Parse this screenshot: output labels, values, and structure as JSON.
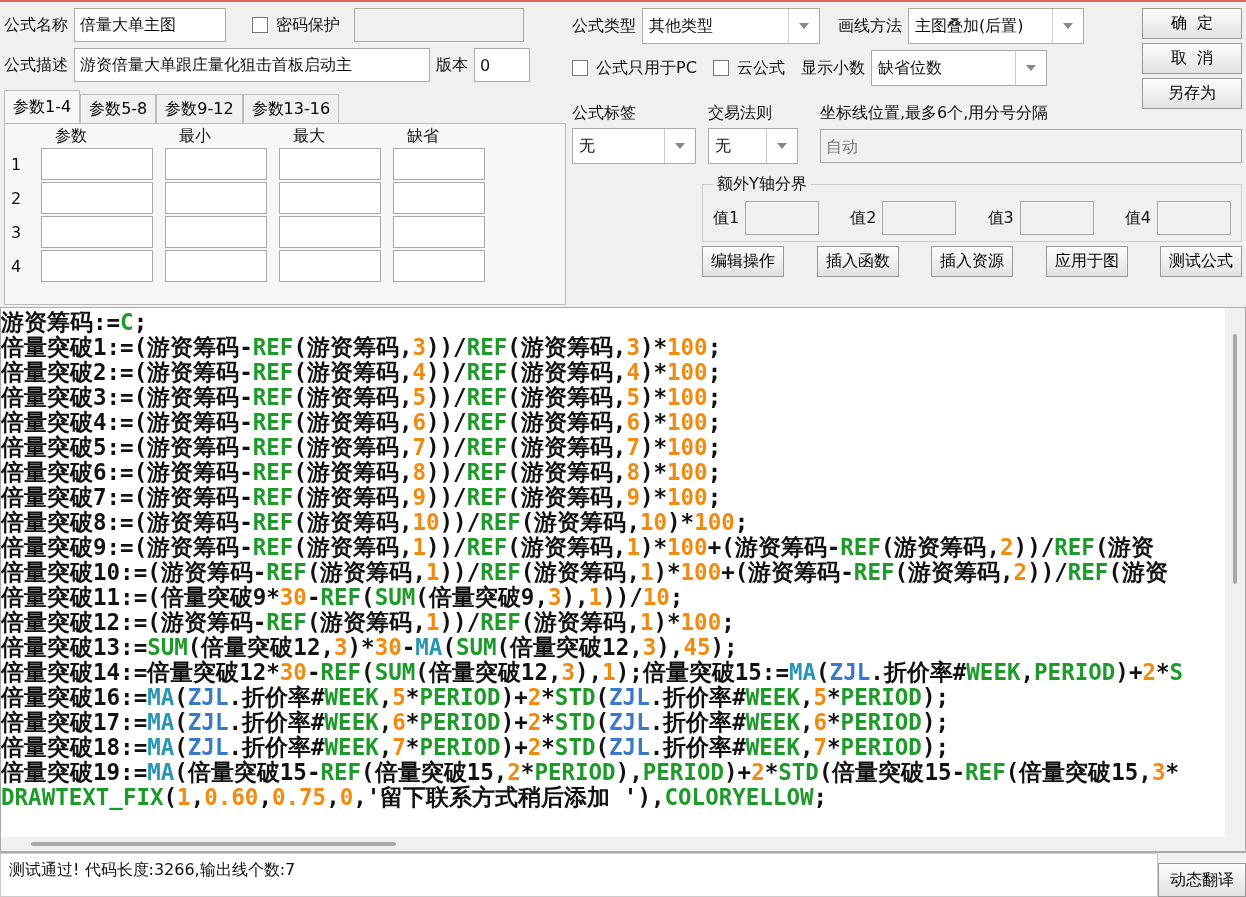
{
  "form": {
    "name_label": "公式名称",
    "name_value": "倍量大单主图",
    "password": {
      "label": "密码保护",
      "checked": false
    },
    "description_label": "公式描述",
    "description_value": "游资倍量大单跟庄量化狙击首板启动主",
    "version_label": "版本",
    "version_value": "0"
  },
  "param_tabs": [
    {
      "label": "参数1-4",
      "selected": true
    },
    {
      "label": "参数5-8",
      "selected": false
    },
    {
      "label": "参数9-12",
      "selected": false
    },
    {
      "label": "参数13-16",
      "selected": false
    }
  ],
  "param_table": {
    "columns": [
      "参数",
      "最小",
      "最大",
      "缺省"
    ],
    "rows": [
      "1",
      "2",
      "3",
      "4"
    ]
  },
  "type": {
    "label": "公式类型",
    "value": "其他类型"
  },
  "draw_method": {
    "label": "画线方法",
    "value": "主图叠加(后置)"
  },
  "options": [
    {
      "label": "公式只用于PC",
      "checked": false
    },
    {
      "label": "云公式",
      "checked": false
    }
  ],
  "decimals": {
    "label": "显示小数",
    "value": "缺省位数"
  },
  "dialog_buttons": [
    "确  定",
    "取  消",
    "另存为"
  ],
  "tag": {
    "label": "公式标签",
    "value": "无"
  },
  "trade_rule": {
    "label": "交易法则",
    "value": "无"
  },
  "axis_lines": {
    "label": "坐标线位置,最多6个,用分号分隔",
    "placeholder": "自动"
  },
  "y_bounds": {
    "title": "额外Y轴分界",
    "fields": [
      "值1",
      "值2",
      "值3",
      "值4"
    ]
  },
  "tool_buttons": [
    "编辑操作",
    "插入函数",
    "插入资源",
    "应用于图",
    "测试公式"
  ],
  "code": [
    [
      {
        "kind": "plain",
        "text": "游资筹码:="
      },
      {
        "kind": "keyword",
        "text": "C"
      },
      {
        "kind": "plain",
        "text": ";"
      }
    ],
    [
      {
        "kind": "plain",
        "text": "倍量突破1:=(游资筹码-"
      },
      {
        "kind": "keyword",
        "text": "REF"
      },
      {
        "kind": "plain",
        "text": "(游资筹码,"
      },
      {
        "kind": "number",
        "text": "3"
      },
      {
        "kind": "plain",
        "text": "))/"
      },
      {
        "kind": "keyword",
        "text": "REF"
      },
      {
        "kind": "plain",
        "text": "(游资筹码,"
      },
      {
        "kind": "number",
        "text": "3"
      },
      {
        "kind": "plain",
        "text": ")*"
      },
      {
        "kind": "number",
        "text": "100"
      },
      {
        "kind": "plain",
        "text": ";"
      }
    ],
    [
      {
        "kind": "plain",
        "text": "倍量突破2:=(游资筹码-"
      },
      {
        "kind": "keyword",
        "text": "REF"
      },
      {
        "kind": "plain",
        "text": "(游资筹码,"
      },
      {
        "kind": "number",
        "text": "4"
      },
      {
        "kind": "plain",
        "text": "))/"
      },
      {
        "kind": "keyword",
        "text": "REF"
      },
      {
        "kind": "plain",
        "text": "(游资筹码,"
      },
      {
        "kind": "number",
        "text": "4"
      },
      {
        "kind": "plain",
        "text": ")*"
      },
      {
        "kind": "number",
        "text": "100"
      },
      {
        "kind": "plain",
        "text": ";"
      }
    ],
    [
      {
        "kind": "plain",
        "text": "倍量突破3:=(游资筹码-"
      },
      {
        "kind": "keyword",
        "text": "REF"
      },
      {
        "kind": "plain",
        "text": "(游资筹码,"
      },
      {
        "kind": "number",
        "text": "5"
      },
      {
        "kind": "plain",
        "text": "))/"
      },
      {
        "kind": "keyword",
        "text": "REF"
      },
      {
        "kind": "plain",
        "text": "(游资筹码,"
      },
      {
        "kind": "number",
        "text": "5"
      },
      {
        "kind": "plain",
        "text": ")*"
      },
      {
        "kind": "number",
        "text": "100"
      },
      {
        "kind": "plain",
        "text": ";"
      }
    ],
    [
      {
        "kind": "plain",
        "text": "倍量突破4:=(游资筹码-"
      },
      {
        "kind": "keyword",
        "text": "REF"
      },
      {
        "kind": "plain",
        "text": "(游资筹码,"
      },
      {
        "kind": "number",
        "text": "6"
      },
      {
        "kind": "plain",
        "text": "))/"
      },
      {
        "kind": "keyword",
        "text": "REF"
      },
      {
        "kind": "plain",
        "text": "(游资筹码,"
      },
      {
        "kind": "number",
        "text": "6"
      },
      {
        "kind": "plain",
        "text": ")*"
      },
      {
        "kind": "number",
        "text": "100"
      },
      {
        "kind": "plain",
        "text": ";"
      }
    ],
    [
      {
        "kind": "plain",
        "text": "倍量突破5:=(游资筹码-"
      },
      {
        "kind": "keyword",
        "text": "REF"
      },
      {
        "kind": "plain",
        "text": "(游资筹码,"
      },
      {
        "kind": "number",
        "text": "7"
      },
      {
        "kind": "plain",
        "text": "))/"
      },
      {
        "kind": "keyword",
        "text": "REF"
      },
      {
        "kind": "plain",
        "text": "(游资筹码,"
      },
      {
        "kind": "number",
        "text": "7"
      },
      {
        "kind": "plain",
        "text": ")*"
      },
      {
        "kind": "number",
        "text": "100"
      },
      {
        "kind": "plain",
        "text": ";"
      }
    ],
    [
      {
        "kind": "plain",
        "text": "倍量突破6:=(游资筹码-"
      },
      {
        "kind": "keyword",
        "text": "REF"
      },
      {
        "kind": "plain",
        "text": "(游资筹码,"
      },
      {
        "kind": "number",
        "text": "8"
      },
      {
        "kind": "plain",
        "text": "))/"
      },
      {
        "kind": "keyword",
        "text": "REF"
      },
      {
        "kind": "plain",
        "text": "(游资筹码,"
      },
      {
        "kind": "number",
        "text": "8"
      },
      {
        "kind": "plain",
        "text": ")*"
      },
      {
        "kind": "number",
        "text": "100"
      },
      {
        "kind": "plain",
        "text": ";"
      }
    ],
    [
      {
        "kind": "plain",
        "text": "倍量突破7:=(游资筹码-"
      },
      {
        "kind": "keyword",
        "text": "REF"
      },
      {
        "kind": "plain",
        "text": "(游资筹码,"
      },
      {
        "kind": "number",
        "text": "9"
      },
      {
        "kind": "plain",
        "text": "))/"
      },
      {
        "kind": "keyword",
        "text": "REF"
      },
      {
        "kind": "plain",
        "text": "(游资筹码,"
      },
      {
        "kind": "number",
        "text": "9"
      },
      {
        "kind": "plain",
        "text": ")*"
      },
      {
        "kind": "number",
        "text": "100"
      },
      {
        "kind": "plain",
        "text": ";"
      }
    ],
    [
      {
        "kind": "plain",
        "text": "倍量突破8:=(游资筹码-"
      },
      {
        "kind": "keyword",
        "text": "REF"
      },
      {
        "kind": "plain",
        "text": "(游资筹码,"
      },
      {
        "kind": "number",
        "text": "10"
      },
      {
        "kind": "plain",
        "text": "))/"
      },
      {
        "kind": "keyword",
        "text": "REF"
      },
      {
        "kind": "plain",
        "text": "(游资筹码,"
      },
      {
        "kind": "number",
        "text": "10"
      },
      {
        "kind": "plain",
        "text": ")*"
      },
      {
        "kind": "number",
        "text": "100"
      },
      {
        "kind": "plain",
        "text": ";"
      }
    ],
    [
      {
        "kind": "plain",
        "text": "倍量突破9:=(游资筹码-"
      },
      {
        "kind": "keyword",
        "text": "REF"
      },
      {
        "kind": "plain",
        "text": "(游资筹码,"
      },
      {
        "kind": "number",
        "text": "1"
      },
      {
        "kind": "plain",
        "text": "))/"
      },
      {
        "kind": "keyword",
        "text": "REF"
      },
      {
        "kind": "plain",
        "text": "(游资筹码,"
      },
      {
        "kind": "number",
        "text": "1"
      },
      {
        "kind": "plain",
        "text": ")*"
      },
      {
        "kind": "number",
        "text": "100"
      },
      {
        "kind": "plain",
        "text": "+(游资筹码-"
      },
      {
        "kind": "keyword",
        "text": "REF"
      },
      {
        "kind": "plain",
        "text": "(游资筹码,"
      },
      {
        "kind": "number",
        "text": "2"
      },
      {
        "kind": "plain",
        "text": "))/"
      },
      {
        "kind": "keyword",
        "text": "REF"
      },
      {
        "kind": "plain",
        "text": "(游资"
      }
    ],
    [
      {
        "kind": "plain",
        "text": "倍量突破10:=(游资筹码-"
      },
      {
        "kind": "keyword",
        "text": "REF"
      },
      {
        "kind": "plain",
        "text": "(游资筹码,"
      },
      {
        "kind": "number",
        "text": "1"
      },
      {
        "kind": "plain",
        "text": "))/"
      },
      {
        "kind": "keyword",
        "text": "REF"
      },
      {
        "kind": "plain",
        "text": "(游资筹码,"
      },
      {
        "kind": "number",
        "text": "1"
      },
      {
        "kind": "plain",
        "text": ")*"
      },
      {
        "kind": "number",
        "text": "100"
      },
      {
        "kind": "plain",
        "text": "+(游资筹码-"
      },
      {
        "kind": "keyword",
        "text": "REF"
      },
      {
        "kind": "plain",
        "text": "(游资筹码,"
      },
      {
        "kind": "number",
        "text": "2"
      },
      {
        "kind": "plain",
        "text": "))/"
      },
      {
        "kind": "keyword",
        "text": "REF"
      },
      {
        "kind": "plain",
        "text": "(游资"
      }
    ],
    [
      {
        "kind": "plain",
        "text": "倍量突破11:=(倍量突破9*"
      },
      {
        "kind": "number",
        "text": "30"
      },
      {
        "kind": "plain",
        "text": "-"
      },
      {
        "kind": "keyword",
        "text": "REF"
      },
      {
        "kind": "plain",
        "text": "("
      },
      {
        "kind": "keyword",
        "text": "SUM"
      },
      {
        "kind": "plain",
        "text": "(倍量突破9,"
      },
      {
        "kind": "number",
        "text": "3"
      },
      {
        "kind": "plain",
        "text": "),"
      },
      {
        "kind": "number",
        "text": "1"
      },
      {
        "kind": "plain",
        "text": "))/"
      },
      {
        "kind": "number",
        "text": "10"
      },
      {
        "kind": "plain",
        "text": ";"
      }
    ],
    [
      {
        "kind": "plain",
        "text": "倍量突破12:=(游资筹码-"
      },
      {
        "kind": "keyword",
        "text": "REF"
      },
      {
        "kind": "plain",
        "text": "(游资筹码,"
      },
      {
        "kind": "number",
        "text": "1"
      },
      {
        "kind": "plain",
        "text": "))/"
      },
      {
        "kind": "keyword",
        "text": "REF"
      },
      {
        "kind": "plain",
        "text": "(游资筹码,"
      },
      {
        "kind": "number",
        "text": "1"
      },
      {
        "kind": "plain",
        "text": ")*"
      },
      {
        "kind": "number",
        "text": "100"
      },
      {
        "kind": "plain",
        "text": ";"
      }
    ],
    [
      {
        "kind": "plain",
        "text": "倍量突破13:="
      },
      {
        "kind": "keyword",
        "text": "SUM"
      },
      {
        "kind": "plain",
        "text": "(倍量突破12,"
      },
      {
        "kind": "number",
        "text": "3"
      },
      {
        "kind": "plain",
        "text": ")*"
      },
      {
        "kind": "number",
        "text": "30"
      },
      {
        "kind": "plain",
        "text": "-"
      },
      {
        "kind": "function",
        "text": "MA"
      },
      {
        "kind": "plain",
        "text": "("
      },
      {
        "kind": "keyword",
        "text": "SUM"
      },
      {
        "kind": "plain",
        "text": "(倍量突破12,"
      },
      {
        "kind": "number",
        "text": "3"
      },
      {
        "kind": "plain",
        "text": "),"
      },
      {
        "kind": "number",
        "text": "45"
      },
      {
        "kind": "plain",
        "text": ");"
      }
    ],
    [
      {
        "kind": "plain",
        "text": "倍量突破14:=倍量突破12*"
      },
      {
        "kind": "number",
        "text": "30"
      },
      {
        "kind": "plain",
        "text": "-"
      },
      {
        "kind": "keyword",
        "text": "REF"
      },
      {
        "kind": "plain",
        "text": "("
      },
      {
        "kind": "keyword",
        "text": "SUM"
      },
      {
        "kind": "plain",
        "text": "(倍量突破12,"
      },
      {
        "kind": "number",
        "text": "3"
      },
      {
        "kind": "plain",
        "text": "),"
      },
      {
        "kind": "number",
        "text": "1"
      },
      {
        "kind": "plain",
        "text": ");倍量突破15:="
      },
      {
        "kind": "function",
        "text": "MA"
      },
      {
        "kind": "plain",
        "text": "("
      },
      {
        "kind": "variable",
        "text": "ZJL"
      },
      {
        "kind": "plain",
        "text": ".折价率#"
      },
      {
        "kind": "keyword",
        "text": "WEEK"
      },
      {
        "kind": "plain",
        "text": ","
      },
      {
        "kind": "keyword",
        "text": "PERIOD"
      },
      {
        "kind": "plain",
        "text": ")+"
      },
      {
        "kind": "number",
        "text": "2"
      },
      {
        "kind": "plain",
        "text": "*"
      },
      {
        "kind": "keyword",
        "text": "S"
      }
    ],
    [
      {
        "kind": "plain",
        "text": "倍量突破16:="
      },
      {
        "kind": "function",
        "text": "MA"
      },
      {
        "kind": "plain",
        "text": "("
      },
      {
        "kind": "variable",
        "text": "ZJL"
      },
      {
        "kind": "plain",
        "text": ".折价率#"
      },
      {
        "kind": "keyword",
        "text": "WEEK"
      },
      {
        "kind": "plain",
        "text": ","
      },
      {
        "kind": "number",
        "text": "5"
      },
      {
        "kind": "plain",
        "text": "*"
      },
      {
        "kind": "keyword",
        "text": "PERIOD"
      },
      {
        "kind": "plain",
        "text": ")+"
      },
      {
        "kind": "number",
        "text": "2"
      },
      {
        "kind": "plain",
        "text": "*"
      },
      {
        "kind": "keyword",
        "text": "STD"
      },
      {
        "kind": "plain",
        "text": "("
      },
      {
        "kind": "variable",
        "text": "ZJL"
      },
      {
        "kind": "plain",
        "text": ".折价率#"
      },
      {
        "kind": "keyword",
        "text": "WEEK"
      },
      {
        "kind": "plain",
        "text": ","
      },
      {
        "kind": "number",
        "text": "5"
      },
      {
        "kind": "plain",
        "text": "*"
      },
      {
        "kind": "keyword",
        "text": "PERIOD"
      },
      {
        "kind": "plain",
        "text": ");"
      }
    ],
    [
      {
        "kind": "plain",
        "text": "倍量突破17:="
      },
      {
        "kind": "function",
        "text": "MA"
      },
      {
        "kind": "plain",
        "text": "("
      },
      {
        "kind": "variable",
        "text": "ZJL"
      },
      {
        "kind": "plain",
        "text": ".折价率#"
      },
      {
        "kind": "keyword",
        "text": "WEEK"
      },
      {
        "kind": "plain",
        "text": ","
      },
      {
        "kind": "number",
        "text": "6"
      },
      {
        "kind": "plain",
        "text": "*"
      },
      {
        "kind": "keyword",
        "text": "PERIOD"
      },
      {
        "kind": "plain",
        "text": ")+"
      },
      {
        "kind": "number",
        "text": "2"
      },
      {
        "kind": "plain",
        "text": "*"
      },
      {
        "kind": "keyword",
        "text": "STD"
      },
      {
        "kind": "plain",
        "text": "("
      },
      {
        "kind": "variable",
        "text": "ZJL"
      },
      {
        "kind": "plain",
        "text": ".折价率#"
      },
      {
        "kind": "keyword",
        "text": "WEEK"
      },
      {
        "kind": "plain",
        "text": ","
      },
      {
        "kind": "number",
        "text": "6"
      },
      {
        "kind": "plain",
        "text": "*"
      },
      {
        "kind": "keyword",
        "text": "PERIOD"
      },
      {
        "kind": "plain",
        "text": ");"
      }
    ],
    [
      {
        "kind": "plain",
        "text": "倍量突破18:="
      },
      {
        "kind": "function",
        "text": "MA"
      },
      {
        "kind": "plain",
        "text": "("
      },
      {
        "kind": "variable",
        "text": "ZJL"
      },
      {
        "kind": "plain",
        "text": ".折价率#"
      },
      {
        "kind": "keyword",
        "text": "WEEK"
      },
      {
        "kind": "plain",
        "text": ","
      },
      {
        "kind": "number",
        "text": "7"
      },
      {
        "kind": "plain",
        "text": "*"
      },
      {
        "kind": "keyword",
        "text": "PERIOD"
      },
      {
        "kind": "plain",
        "text": ")+"
      },
      {
        "kind": "number",
        "text": "2"
      },
      {
        "kind": "plain",
        "text": "*"
      },
      {
        "kind": "keyword",
        "text": "STD"
      },
      {
        "kind": "plain",
        "text": "("
      },
      {
        "kind": "variable",
        "text": "ZJL"
      },
      {
        "kind": "plain",
        "text": ".折价率#"
      },
      {
        "kind": "keyword",
        "text": "WEEK"
      },
      {
        "kind": "plain",
        "text": ","
      },
      {
        "kind": "number",
        "text": "7"
      },
      {
        "kind": "plain",
        "text": "*"
      },
      {
        "kind": "keyword",
        "text": "PERIOD"
      },
      {
        "kind": "plain",
        "text": ");"
      }
    ],
    [
      {
        "kind": "plain",
        "text": "倍量突破19:="
      },
      {
        "kind": "function",
        "text": "MA"
      },
      {
        "kind": "plain",
        "text": "(倍量突破15-"
      },
      {
        "kind": "keyword",
        "text": "REF"
      },
      {
        "kind": "plain",
        "text": "(倍量突破15,"
      },
      {
        "kind": "number",
        "text": "2"
      },
      {
        "kind": "plain",
        "text": "*"
      },
      {
        "kind": "keyword",
        "text": "PERIOD"
      },
      {
        "kind": "plain",
        "text": "),"
      },
      {
        "kind": "keyword",
        "text": "PERIOD"
      },
      {
        "kind": "plain",
        "text": ")+"
      },
      {
        "kind": "number",
        "text": "2"
      },
      {
        "kind": "plain",
        "text": "*"
      },
      {
        "kind": "keyword",
        "text": "STD"
      },
      {
        "kind": "plain",
        "text": "(倍量突破15-"
      },
      {
        "kind": "keyword",
        "text": "REF"
      },
      {
        "kind": "plain",
        "text": "(倍量突破15,"
      },
      {
        "kind": "number",
        "text": "3"
      },
      {
        "kind": "plain",
        "text": "*"
      }
    ],
    [
      {
        "kind": "keyword",
        "text": "DRAWTEXT_FIX"
      },
      {
        "kind": "plain",
        "text": "("
      },
      {
        "kind": "number",
        "text": "1"
      },
      {
        "kind": "plain",
        "text": ","
      },
      {
        "kind": "number",
        "text": "0.60"
      },
      {
        "kind": "plain",
        "text": ","
      },
      {
        "kind": "number",
        "text": "0.75"
      },
      {
        "kind": "plain",
        "text": ","
      },
      {
        "kind": "number",
        "text": "0"
      },
      {
        "kind": "plain",
        "text": ",'留下联系方式稍后添加 '),"
      },
      {
        "kind": "keyword",
        "text": "COLORYELLOW"
      },
      {
        "kind": "plain",
        "text": ";"
      }
    ]
  ],
  "status": {
    "message": "测试通过! 代码长度:3266,输出线个数:7",
    "button": "动态翻译"
  }
}
